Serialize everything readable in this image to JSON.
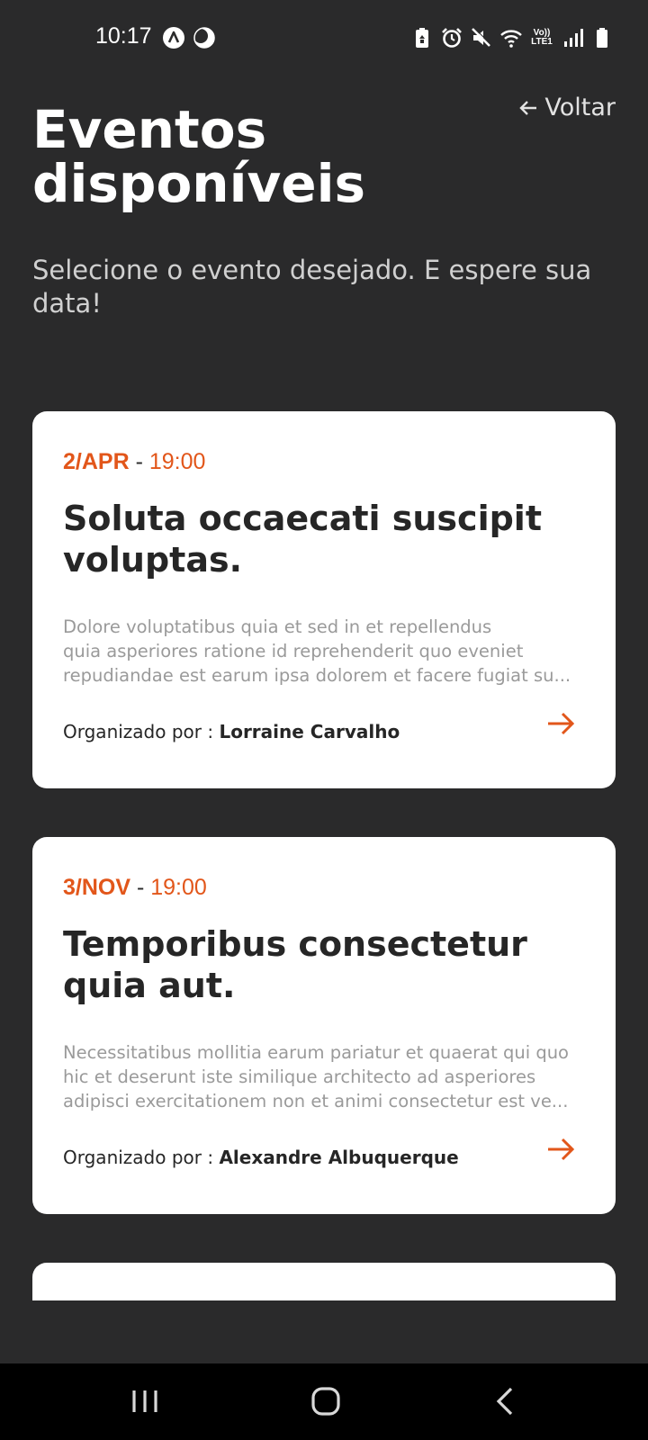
{
  "status_bar": {
    "time": "10:17",
    "left_icons": [
      "app-a-icon",
      "moon-icon"
    ],
    "right_icons": [
      "battery-saver-icon",
      "alarm-icon",
      "mute-icon",
      "wifi-icon",
      "volte-icon",
      "signal-icon",
      "battery-icon"
    ],
    "volte_label_top": "Vo))",
    "volte_label_bottom": "LTE1"
  },
  "header": {
    "back_label": "Voltar",
    "title": "Eventos disponíveis",
    "subtitle": "Selecione o evento desejado. E espere sua data!"
  },
  "events": [
    {
      "day": "2/APR",
      "separator": " - ",
      "time": "19:00",
      "title": "Soluta occaecati suscipit voluptas.",
      "description_lines": [
        "Dolore voluptatibus quia et sed in et repellendus",
        "quia asperiores ratione id reprehenderit quo eveniet",
        "repudiandae est earum ipsa dolorem et facere fugiat su..."
      ],
      "organizer_label": "Organizado por : ",
      "organizer": "Lorraine Carvalho"
    },
    {
      "day": "3/NOV",
      "separator": " - ",
      "time": "19:00",
      "title": "Temporibus consectetur quia aut.",
      "description_lines": [
        "Necessitatibus mollitia earum pariatur et quaerat qui quo",
        "hic et deserunt iste similique architecto ad asperiores",
        "adipisci exercitationem non et animi consectetur est ve..."
      ],
      "organizer_label": "Organizado por : ",
      "organizer": "Alexandre Albuquerque"
    }
  ],
  "colors": {
    "background": "#2a2a2b",
    "accent": "#e2561a",
    "card": "#ffffff",
    "text_dark": "#262626",
    "text_muted": "#9a9a9a"
  },
  "nav_bar": {
    "buttons": [
      "recent-apps-icon",
      "home-icon",
      "back-icon"
    ]
  }
}
